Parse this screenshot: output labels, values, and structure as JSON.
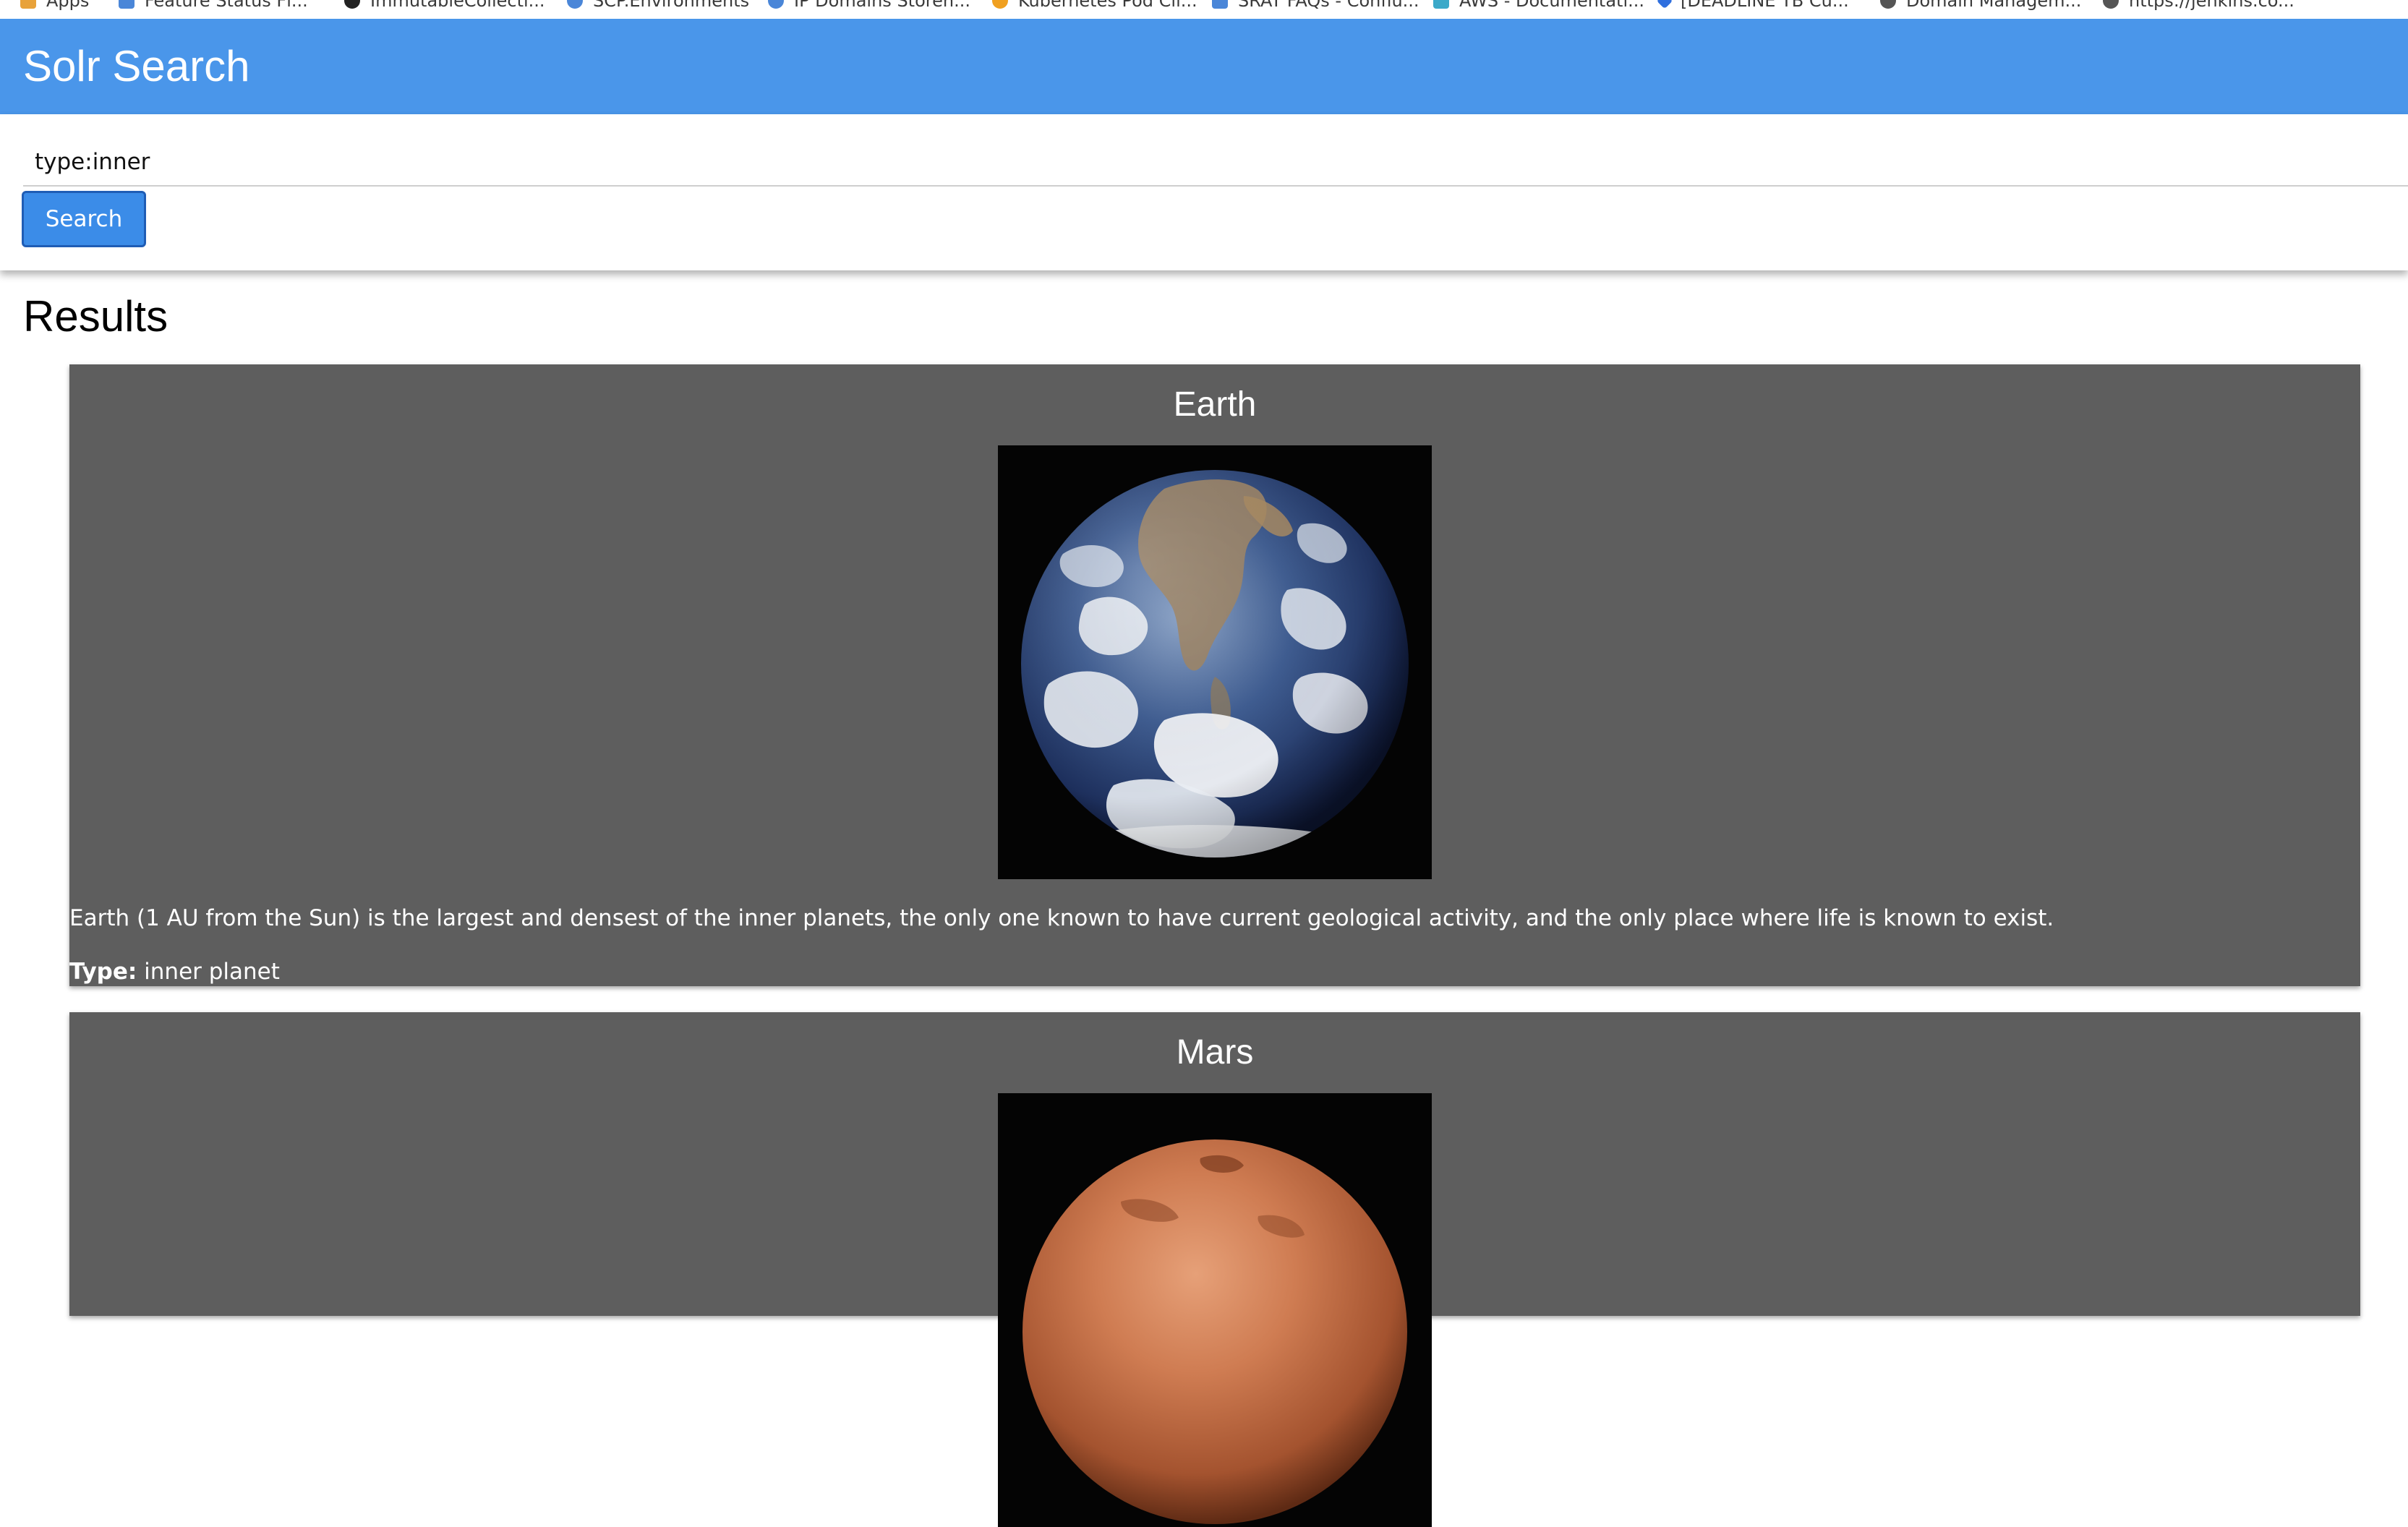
{
  "bookmarks": [
    {
      "label": "Apps",
      "icon": "apps-grid-icon",
      "color": "#e8a23a"
    },
    {
      "label": "Feature Status Fl...",
      "icon": "document-icon",
      "color": "#4a86d8"
    },
    {
      "label": "ImmutableCollecti...",
      "icon": "github-icon",
      "color": "#222222"
    },
    {
      "label": "SCP.Environments",
      "icon": "globe-icon",
      "color": "#4a86d8"
    },
    {
      "label": "IP Domains Storen...",
      "icon": "globe-icon",
      "color": "#4a86d8"
    },
    {
      "label": "Kubernetes Pod Cli...",
      "icon": "kubernetes-icon",
      "color": "#f0a020"
    },
    {
      "label": "SRAT FAQs - Conflu...",
      "icon": "confluence-icon",
      "color": "#4a86d8"
    },
    {
      "label": "AWS - Documentati...",
      "icon": "cube-icon",
      "color": "#3ba9c9"
    },
    {
      "label": "[DEADLINE TB Cu...",
      "icon": "diamond-icon",
      "color": "#2f6fde"
    },
    {
      "label": "Domain Managem...",
      "icon": "globe-icon",
      "color": "#555555"
    },
    {
      "label": "https://jenkins.co...",
      "icon": "globe-icon",
      "color": "#555555"
    }
  ],
  "header": {
    "title": "Solr Search"
  },
  "search": {
    "value": "type:inner",
    "button_label": "Search"
  },
  "results": {
    "heading": "Results",
    "items": [
      {
        "name": "Earth",
        "description": "Earth (1 AU from the Sun) is the largest and densest of the inner planets, the only one known to have current geological activity, and the only place where life is known to exist.",
        "type_label": "Type:",
        "type_value": "inner planet"
      },
      {
        "name": "Mars"
      }
    ]
  },
  "colors": {
    "header": "#4a96ea",
    "card": "#5e5e5e",
    "button": "#3b8ce8"
  }
}
